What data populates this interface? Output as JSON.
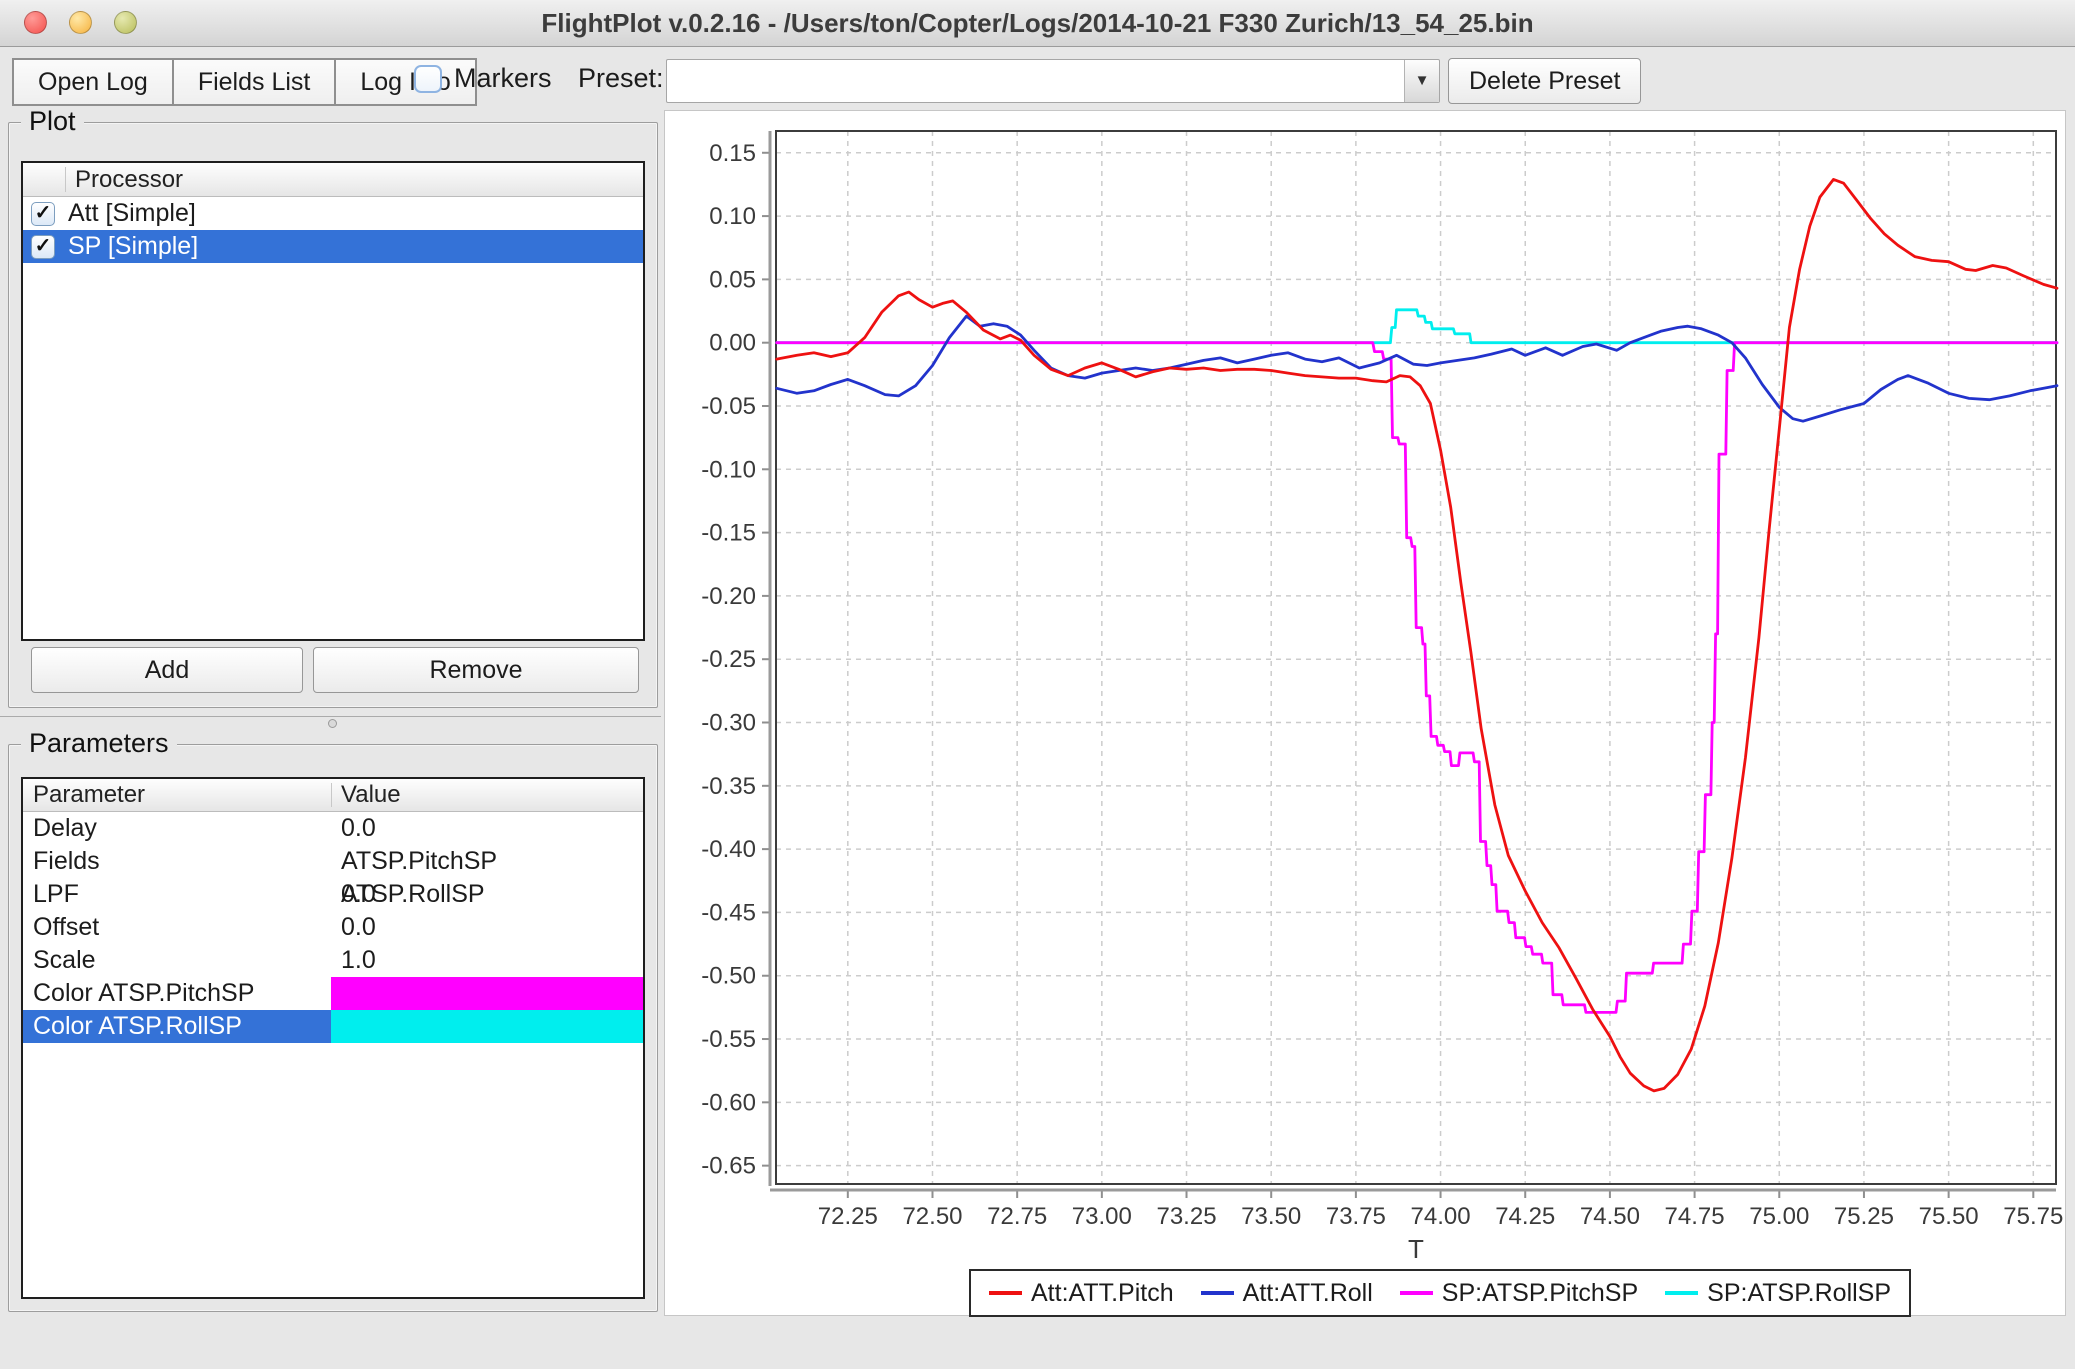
{
  "window": {
    "title": "FlightPlot v.0.2.16 - /Users/ton/Copter/Logs/2014-10-21 F330 Zurich/13_54_25.bin"
  },
  "toolbar": {
    "open_log": "Open Log",
    "fields_list": "Fields List",
    "log_info": "Log Info",
    "markers_label": "Markers",
    "markers_checked": false,
    "preset_label": "Preset:",
    "preset_value": "",
    "delete_preset": "Delete Preset",
    "combo_arrow": "▼"
  },
  "plot_panel": {
    "title": "Plot",
    "column_header": "Processor",
    "rows": [
      {
        "label": "Att [Simple]",
        "checked": true,
        "selected": false
      },
      {
        "label": "SP [Simple]",
        "checked": true,
        "selected": true
      }
    ],
    "add_button": "Add",
    "remove_button": "Remove"
  },
  "parameters_panel": {
    "title": "Parameters",
    "columns": [
      "Parameter",
      "Value"
    ],
    "rows": [
      {
        "parameter": "Delay",
        "value": "0.0"
      },
      {
        "parameter": "Fields",
        "value": "ATSP.PitchSP ATSP.RollSP"
      },
      {
        "parameter": "LPF",
        "value": "0.0"
      },
      {
        "parameter": "Offset",
        "value": "0.0"
      },
      {
        "parameter": "Scale",
        "value": "1.0"
      },
      {
        "parameter": "Color ATSP.PitchSP",
        "value": "",
        "value_color": "#ff00ff"
      },
      {
        "parameter": "Color ATSP.RollSP",
        "value": "",
        "value_color": "#00eeee",
        "selected": true
      }
    ]
  },
  "colors": {
    "selection": "#3472d7",
    "window_background": "#e7e7e7"
  },
  "chart_data": {
    "type": "line",
    "title": "",
    "xlabel": "T",
    "ylabel": "",
    "grid": true,
    "grid_color": "#cccccc",
    "legend_position": "bottom",
    "x_range": [
      72.038,
      75.817
    ],
    "y_range": [
      -0.6645,
      0.1672
    ],
    "x_ticks": [
      "72.25",
      "72.50",
      "72.75",
      "73.00",
      "73.25",
      "73.50",
      "73.75",
      "74.00",
      "74.25",
      "74.50",
      "74.75",
      "75.00",
      "75.25",
      "75.50",
      "75.75"
    ],
    "y_ticks": [
      "0.15",
      "0.10",
      "0.05",
      "0.00",
      "-0.05",
      "-0.10",
      "-0.15",
      "-0.20",
      "-0.25",
      "-0.30",
      "-0.35",
      "-0.40",
      "-0.45",
      "-0.50",
      "-0.55",
      "-0.60",
      "-0.65"
    ],
    "draw_order": [
      3,
      2,
      1,
      0
    ],
    "series": [
      {
        "name": "Att:ATT.Pitch",
        "color": "#ee1111",
        "points": [
          [
            72.04,
            -0.013
          ],
          [
            72.1,
            -0.01
          ],
          [
            72.15,
            -0.008
          ],
          [
            72.2,
            -0.011
          ],
          [
            72.25,
            -0.008
          ],
          [
            72.3,
            0.004
          ],
          [
            72.35,
            0.024
          ],
          [
            72.4,
            0.037
          ],
          [
            72.43,
            0.04
          ],
          [
            72.46,
            0.034
          ],
          [
            72.5,
            0.028
          ],
          [
            72.53,
            0.031
          ],
          [
            72.56,
            0.033
          ],
          [
            72.6,
            0.024
          ],
          [
            72.65,
            0.01
          ],
          [
            72.7,
            0.003
          ],
          [
            72.73,
            0.006
          ],
          [
            72.76,
            0.002
          ],
          [
            72.8,
            -0.01
          ],
          [
            72.85,
            -0.021
          ],
          [
            72.9,
            -0.026
          ],
          [
            72.95,
            -0.02
          ],
          [
            73.0,
            -0.016
          ],
          [
            73.05,
            -0.021
          ],
          [
            73.1,
            -0.027
          ],
          [
            73.15,
            -0.023
          ],
          [
            73.2,
            -0.02
          ],
          [
            73.25,
            -0.021
          ],
          [
            73.3,
            -0.02
          ],
          [
            73.35,
            -0.022
          ],
          [
            73.4,
            -0.021
          ],
          [
            73.45,
            -0.021
          ],
          [
            73.5,
            -0.022
          ],
          [
            73.55,
            -0.024
          ],
          [
            73.6,
            -0.026
          ],
          [
            73.65,
            -0.027
          ],
          [
            73.7,
            -0.028
          ],
          [
            73.75,
            -0.028
          ],
          [
            73.8,
            -0.03
          ],
          [
            73.84,
            -0.031
          ],
          [
            73.88,
            -0.026
          ],
          [
            73.91,
            -0.027
          ],
          [
            73.94,
            -0.034
          ],
          [
            73.97,
            -0.048
          ],
          [
            74.0,
            -0.085
          ],
          [
            74.03,
            -0.13
          ],
          [
            74.06,
            -0.19
          ],
          [
            74.09,
            -0.245
          ],
          [
            74.12,
            -0.305
          ],
          [
            74.16,
            -0.365
          ],
          [
            74.2,
            -0.405
          ],
          [
            74.25,
            -0.433
          ],
          [
            74.3,
            -0.458
          ],
          [
            74.35,
            -0.478
          ],
          [
            74.4,
            -0.502
          ],
          [
            74.45,
            -0.527
          ],
          [
            74.5,
            -0.548
          ],
          [
            74.53,
            -0.564
          ],
          [
            74.56,
            -0.577
          ],
          [
            74.6,
            -0.587
          ],
          [
            74.63,
            -0.591
          ],
          [
            74.66,
            -0.589
          ],
          [
            74.7,
            -0.578
          ],
          [
            74.74,
            -0.558
          ],
          [
            74.78,
            -0.524
          ],
          [
            74.82,
            -0.474
          ],
          [
            74.86,
            -0.407
          ],
          [
            74.9,
            -0.328
          ],
          [
            74.94,
            -0.233
          ],
          [
            74.97,
            -0.148
          ],
          [
            75.0,
            -0.068
          ],
          [
            75.03,
            0.012
          ],
          [
            75.06,
            0.058
          ],
          [
            75.09,
            0.092
          ],
          [
            75.12,
            0.115
          ],
          [
            75.16,
            0.129
          ],
          [
            75.19,
            0.126
          ],
          [
            75.23,
            0.112
          ],
          [
            75.27,
            0.098
          ],
          [
            75.31,
            0.086
          ],
          [
            75.35,
            0.077
          ],
          [
            75.4,
            0.068
          ],
          [
            75.45,
            0.065
          ],
          [
            75.5,
            0.064
          ],
          [
            75.55,
            0.058
          ],
          [
            75.58,
            0.057
          ],
          [
            75.63,
            0.061
          ],
          [
            75.67,
            0.059
          ],
          [
            75.72,
            0.053
          ],
          [
            75.78,
            0.046
          ],
          [
            75.82,
            0.043
          ]
        ]
      },
      {
        "name": "Att:ATT.Roll",
        "color": "#2233cc",
        "points": [
          [
            72.04,
            -0.036
          ],
          [
            72.1,
            -0.04
          ],
          [
            72.15,
            -0.038
          ],
          [
            72.2,
            -0.033
          ],
          [
            72.25,
            -0.029
          ],
          [
            72.3,
            -0.034
          ],
          [
            72.36,
            -0.041
          ],
          [
            72.4,
            -0.042
          ],
          [
            72.45,
            -0.034
          ],
          [
            72.5,
            -0.018
          ],
          [
            72.55,
            0.004
          ],
          [
            72.6,
            0.021
          ],
          [
            72.64,
            0.013
          ],
          [
            72.68,
            0.015
          ],
          [
            72.72,
            0.013
          ],
          [
            72.76,
            0.006
          ],
          [
            72.8,
            -0.006
          ],
          [
            72.85,
            -0.02
          ],
          [
            72.9,
            -0.026
          ],
          [
            72.95,
            -0.028
          ],
          [
            73.0,
            -0.024
          ],
          [
            73.05,
            -0.022
          ],
          [
            73.1,
            -0.02
          ],
          [
            73.15,
            -0.022
          ],
          [
            73.2,
            -0.02
          ],
          [
            73.25,
            -0.017
          ],
          [
            73.3,
            -0.014
          ],
          [
            73.35,
            -0.012
          ],
          [
            73.4,
            -0.016
          ],
          [
            73.45,
            -0.013
          ],
          [
            73.5,
            -0.01
          ],
          [
            73.55,
            -0.008
          ],
          [
            73.6,
            -0.013
          ],
          [
            73.65,
            -0.015
          ],
          [
            73.7,
            -0.012
          ],
          [
            73.76,
            -0.02
          ],
          [
            73.82,
            -0.016
          ],
          [
            73.87,
            -0.01
          ],
          [
            73.92,
            -0.017
          ],
          [
            73.96,
            -0.018
          ],
          [
            74.0,
            -0.016
          ],
          [
            74.05,
            -0.014
          ],
          [
            74.1,
            -0.012
          ],
          [
            74.15,
            -0.009
          ],
          [
            74.21,
            -0.005
          ],
          [
            74.25,
            -0.01
          ],
          [
            74.31,
            -0.004
          ],
          [
            74.36,
            -0.01
          ],
          [
            74.42,
            -0.003
          ],
          [
            74.46,
            -0.001
          ],
          [
            74.52,
            -0.006
          ],
          [
            74.56,
            0.0
          ],
          [
            74.6,
            0.004
          ],
          [
            74.65,
            0.009
          ],
          [
            74.7,
            0.012
          ],
          [
            74.73,
            0.013
          ],
          [
            74.77,
            0.011
          ],
          [
            74.82,
            0.006
          ],
          [
            74.86,
            0.0
          ],
          [
            74.9,
            -0.012
          ],
          [
            74.95,
            -0.033
          ],
          [
            75.0,
            -0.051
          ],
          [
            75.04,
            -0.06
          ],
          [
            75.07,
            -0.062
          ],
          [
            75.12,
            -0.058
          ],
          [
            75.18,
            -0.053
          ],
          [
            75.25,
            -0.048
          ],
          [
            75.3,
            -0.037
          ],
          [
            75.35,
            -0.029
          ],
          [
            75.38,
            -0.026
          ],
          [
            75.44,
            -0.032
          ],
          [
            75.5,
            -0.04
          ],
          [
            75.56,
            -0.044
          ],
          [
            75.62,
            -0.045
          ],
          [
            75.68,
            -0.042
          ],
          [
            75.74,
            -0.038
          ],
          [
            75.82,
            -0.034
          ]
        ]
      },
      {
        "name": "SP:ATSP.PitchSP",
        "color": "#ff00ff",
        "points": [
          [
            72.04,
            0
          ],
          [
            73.8,
            0
          ],
          [
            73.805,
            -0.007
          ],
          [
            73.828,
            -0.007
          ],
          [
            73.832,
            -0.013
          ],
          [
            73.854,
            -0.013
          ],
          [
            73.858,
            -0.075
          ],
          [
            73.874,
            -0.075
          ],
          [
            73.878,
            -0.08
          ],
          [
            73.896,
            -0.08
          ],
          [
            73.9,
            -0.154
          ],
          [
            73.912,
            -0.154
          ],
          [
            73.916,
            -0.161
          ],
          [
            73.924,
            -0.161
          ],
          [
            73.928,
            -0.225
          ],
          [
            73.944,
            -0.225
          ],
          [
            73.948,
            -0.238
          ],
          [
            73.954,
            -0.238
          ],
          [
            73.958,
            -0.279
          ],
          [
            73.968,
            -0.279
          ],
          [
            73.972,
            -0.311
          ],
          [
            73.988,
            -0.311
          ],
          [
            73.992,
            -0.318
          ],
          [
            74.008,
            -0.318
          ],
          [
            74.012,
            -0.323
          ],
          [
            74.028,
            -0.323
          ],
          [
            74.032,
            -0.334
          ],
          [
            74.053,
            -0.334
          ],
          [
            74.057,
            -0.324
          ],
          [
            74.096,
            -0.324
          ],
          [
            74.1,
            -0.331
          ],
          [
            74.114,
            -0.331
          ],
          [
            74.118,
            -0.394
          ],
          [
            74.133,
            -0.394
          ],
          [
            74.137,
            -0.413
          ],
          [
            74.148,
            -0.413
          ],
          [
            74.152,
            -0.428
          ],
          [
            74.163,
            -0.428
          ],
          [
            74.167,
            -0.449
          ],
          [
            74.198,
            -0.449
          ],
          [
            74.202,
            -0.458
          ],
          [
            74.218,
            -0.458
          ],
          [
            74.222,
            -0.47
          ],
          [
            74.248,
            -0.47
          ],
          [
            74.252,
            -0.477
          ],
          [
            74.268,
            -0.477
          ],
          [
            74.272,
            -0.483
          ],
          [
            74.298,
            -0.483
          ],
          [
            74.302,
            -0.49
          ],
          [
            74.328,
            -0.49
          ],
          [
            74.332,
            -0.515
          ],
          [
            74.358,
            -0.515
          ],
          [
            74.362,
            -0.523
          ],
          [
            74.425,
            -0.523
          ],
          [
            74.429,
            -0.529
          ],
          [
            74.518,
            -0.529
          ],
          [
            74.522,
            -0.52
          ],
          [
            74.545,
            -0.52
          ],
          [
            74.549,
            -0.498
          ],
          [
            74.625,
            -0.498
          ],
          [
            74.629,
            -0.49
          ],
          [
            74.713,
            -0.49
          ],
          [
            74.717,
            -0.475
          ],
          [
            74.738,
            -0.475
          ],
          [
            74.742,
            -0.449
          ],
          [
            74.758,
            -0.449
          ],
          [
            74.762,
            -0.402
          ],
          [
            74.778,
            -0.402
          ],
          [
            74.782,
            -0.357
          ],
          [
            74.798,
            -0.357
          ],
          [
            74.802,
            -0.3
          ],
          [
            74.808,
            -0.3
          ],
          [
            74.812,
            -0.23
          ],
          [
            74.818,
            -0.23
          ],
          [
            74.822,
            -0.088
          ],
          [
            74.842,
            -0.088
          ],
          [
            74.846,
            -0.022
          ],
          [
            74.864,
            -0.022
          ],
          [
            74.868,
            0.0
          ],
          [
            75.82,
            0.0
          ]
        ]
      },
      {
        "name": "SP:ATSP.RollSP",
        "color": "#00eeee",
        "points": [
          [
            72.04,
            0
          ],
          [
            73.852,
            0
          ],
          [
            73.856,
            0.012
          ],
          [
            73.866,
            0.012
          ],
          [
            73.87,
            0.026
          ],
          [
            73.93,
            0.026
          ],
          [
            73.934,
            0.021
          ],
          [
            73.952,
            0.021
          ],
          [
            73.956,
            0.016
          ],
          [
            73.972,
            0.016
          ],
          [
            73.976,
            0.011
          ],
          [
            74.038,
            0.011
          ],
          [
            74.042,
            0.007
          ],
          [
            74.086,
            0.007
          ],
          [
            74.09,
            0.0
          ],
          [
            75.82,
            0.0
          ]
        ]
      }
    ]
  }
}
